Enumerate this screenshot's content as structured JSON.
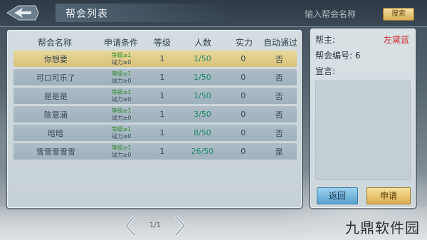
{
  "header": {
    "title": "帮会列表",
    "search_placeholder": "输入帮会名称",
    "search_button": "搜索"
  },
  "table": {
    "columns": [
      "帮会名称",
      "申请条件",
      "等级",
      "人数",
      "实力",
      "自动通过"
    ],
    "rows": [
      {
        "name": "你想要",
        "cond_level": "等级≥1",
        "cond_power": "战力≥0",
        "level": "1",
        "members": "1/50",
        "power": "0",
        "auto": "否",
        "selected": true
      },
      {
        "name": "可口可乐了",
        "cond_level": "等级≥1",
        "cond_power": "战力≥0",
        "level": "1",
        "members": "1/50",
        "power": "0",
        "auto": "否"
      },
      {
        "name": "是是是",
        "cond_level": "等级≥1",
        "cond_power": "战力≥0",
        "level": "1",
        "members": "1/50",
        "power": "0",
        "auto": "否"
      },
      {
        "name": "陈意涵",
        "cond_level": "等级≥1",
        "cond_power": "战力≥0",
        "level": "1",
        "members": "3/50",
        "power": "0",
        "auto": "否"
      },
      {
        "name": "晗晗",
        "cond_level": "等级≥1",
        "cond_power": "战力≥0",
        "level": "1",
        "members": "8/50",
        "power": "0",
        "auto": "否"
      },
      {
        "name": "雪雪雪雪雪",
        "cond_level": "等级≥1",
        "cond_power": "战力≥0",
        "level": "1",
        "members": "26/50",
        "power": "0",
        "auto": "是"
      }
    ]
  },
  "side": {
    "leader_label": "帮主:",
    "leader_value": "左黛蓝",
    "id_label": "帮会编号: 6",
    "declare_label": "宣言:",
    "return_button": "返回",
    "apply_button": "申请"
  },
  "pagination": {
    "current": "1/1"
  },
  "watermark": "九鼎软件园",
  "icons": {
    "back": "back-arrow-icon",
    "prev": "chevron-left-icon",
    "next": "chevron-right-icon"
  },
  "colors": {
    "selected_row": "#e0cd88",
    "row": "#a8b8c3",
    "member_count": "#1e8a6a",
    "condition_level": "#2c8a2c",
    "leader_name": "#d4252a"
  }
}
